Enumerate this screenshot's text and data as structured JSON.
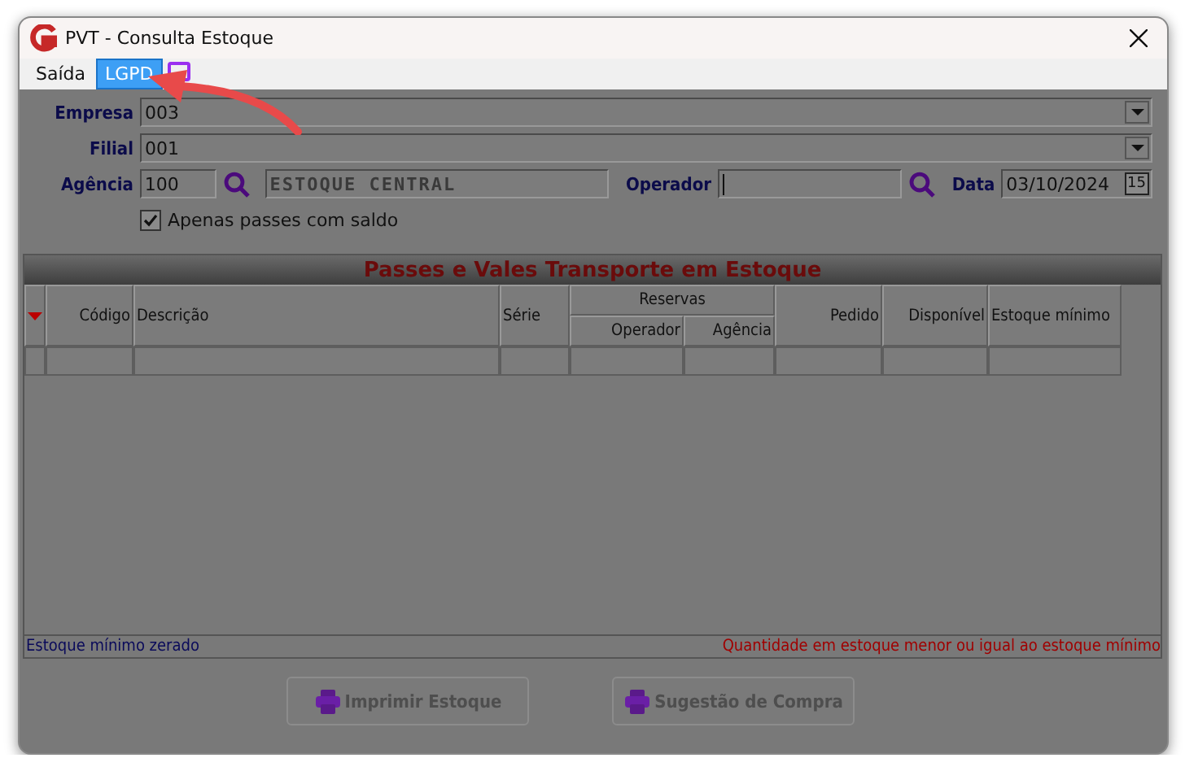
{
  "window": {
    "title": "PVT - Consulta Estoque"
  },
  "menu": [
    {
      "label": "Saída",
      "selected": false
    },
    {
      "label": "LGPD",
      "selected": true
    }
  ],
  "form": {
    "empresa": {
      "label": "Empresa",
      "value": "003"
    },
    "filial": {
      "label": "Filial",
      "value": "001"
    },
    "agencia": {
      "label": "Agência",
      "code": "100",
      "name": "ESTOQUE CENTRAL"
    },
    "operador": {
      "label": "Operador"
    },
    "data": {
      "label": "Data",
      "value": "03/10/2024",
      "calendar": "15"
    },
    "saldo": {
      "label": "Apenas passes com saldo",
      "checked": true
    }
  },
  "grid": {
    "title": "Passes e Vales Transporte em Estoque",
    "columns": [
      {
        "label": "Código"
      },
      {
        "label": "Descrição"
      },
      {
        "label": "Série"
      },
      {
        "label": "Reservas",
        "children": [
          {
            "label": "Operador"
          },
          {
            "label": "Agência"
          }
        ]
      },
      {
        "label": "Pedido"
      },
      {
        "label": "Disponível"
      },
      {
        "label": "Estoque mínimo"
      }
    ]
  },
  "legend": [
    {
      "text": "Estoque mínimo zerado",
      "color": "#0a0a5a"
    },
    {
      "text": "Quantidade em estoque menor ou igual ao estoque mínimo",
      "color": "#a00000"
    }
  ],
  "buttons": [
    {
      "label": "Imprimir Estoque",
      "disabled": true
    },
    {
      "label": "Sugestão de Compra",
      "disabled": true
    }
  ]
}
